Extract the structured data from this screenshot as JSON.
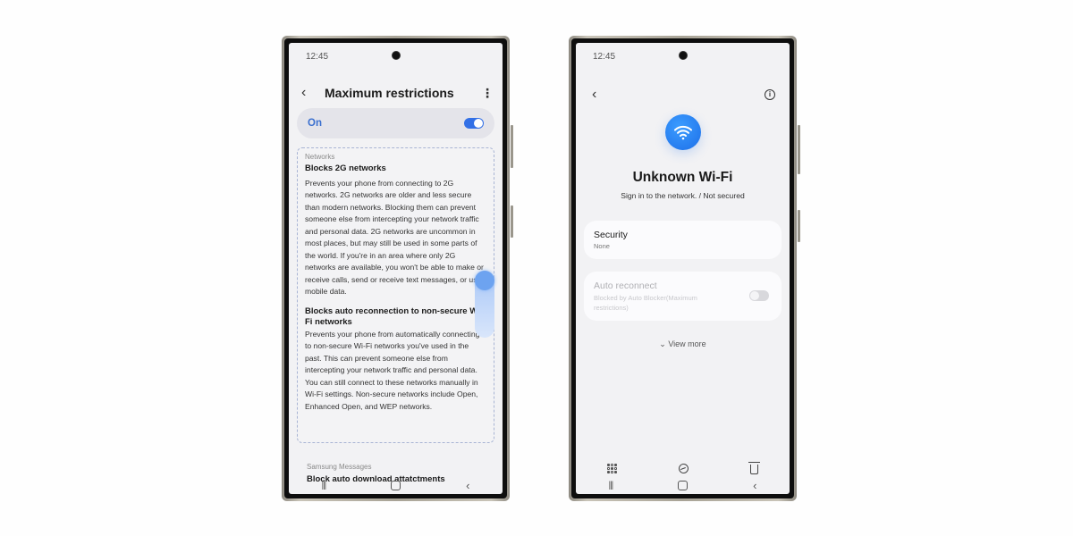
{
  "left_phone": {
    "status_time": "12:45",
    "header": {
      "back_icon": "chevron-left-icon",
      "title": "Maximum restrictions",
      "more_icon": "more-vertical-icon"
    },
    "master_toggle": {
      "label": "On",
      "state": "on"
    },
    "sections": [
      {
        "label": "Networks",
        "items": [
          {
            "title": "Blocks 2G networks",
            "description": "Prevents your phone from connecting to 2G networks. 2G networks are older and less secure than modern networks. Blocking them can prevent someone else from intercepting your network traffic and personal data. 2G networks are uncommon in most places, but may still be used in some parts of the world. If you're in an area where only 2G networks are available, you won't be able to make or receive calls, send or receive text messages, or use mobile data."
          },
          {
            "title": "Blocks auto reconnection to non-secure Wi-Fi networks",
            "description": "Prevents your phone from automatically connecting to non-secure Wi-Fi networks you've used in the past. This can prevent someone else from intercepting your network traffic and personal data. You can still connect to these networks manually in Wi-Fi settings. Non-secure networks include Open, Enhanced Open, and WEP networks."
          }
        ]
      },
      {
        "label": "Samsung Messages",
        "items": [
          {
            "title": "Block auto download attatctments"
          }
        ]
      }
    ],
    "navbar": {
      "recent": "|||",
      "home": "home-icon",
      "back": "‹"
    }
  },
  "right_phone": {
    "status_time": "12:45",
    "header": {
      "back_icon": "chevron-left-icon",
      "info_icon": "info-icon",
      "info_glyph": "i"
    },
    "network": {
      "icon": "wifi-icon",
      "name": "Unknown Wi-Fi",
      "subtitle": "Sign in to the network. / Not secured",
      "accent_color": "#1d6fe8"
    },
    "security": {
      "label": "Security",
      "value": "None"
    },
    "auto_reconnect": {
      "label": "Auto reconnect",
      "note": "Blocked by Auto Blocker(Maximum restrictions)",
      "state": "off",
      "disabled": true
    },
    "view_more": "⌄ View more",
    "actions": [
      {
        "icon": "qr-code-icon"
      },
      {
        "icon": "forget-network-icon"
      },
      {
        "icon": "trash-icon"
      }
    ],
    "navbar": {
      "recent": "|||",
      "home": "home-icon",
      "back": "‹"
    }
  }
}
